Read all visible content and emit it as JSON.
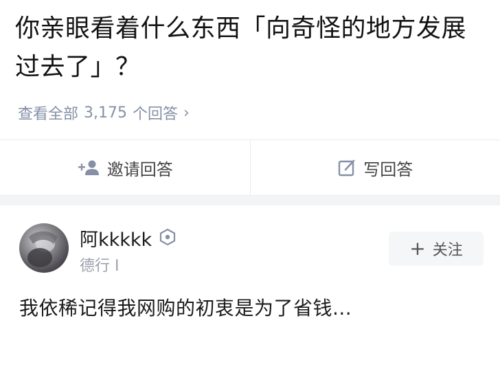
{
  "question": {
    "title": "你亲眼看着什么东西「向奇怪的地方发展过去了」？",
    "view_all_prefix": "查看全部",
    "answer_count": "3,175",
    "view_all_suffix": "个回答",
    "chevron": "›"
  },
  "actions": {
    "invite_label": "邀请回答",
    "invite_icon": "add-person-icon",
    "write_label": "写回答",
    "write_icon": "edit-icon"
  },
  "answer": {
    "username": "阿kkkkk",
    "badge_icon": "hexagon-badge-icon",
    "user_desc": "德行 I",
    "follow_label": "关注",
    "follow_plus": "+",
    "content": "我依稀记得我网购的初衷是为了省钱..."
  },
  "colors": {
    "muted_text": "#8590a6",
    "divider": "#ececec",
    "band": "#f3f4f6",
    "follow_bg": "#f5f6f8"
  }
}
